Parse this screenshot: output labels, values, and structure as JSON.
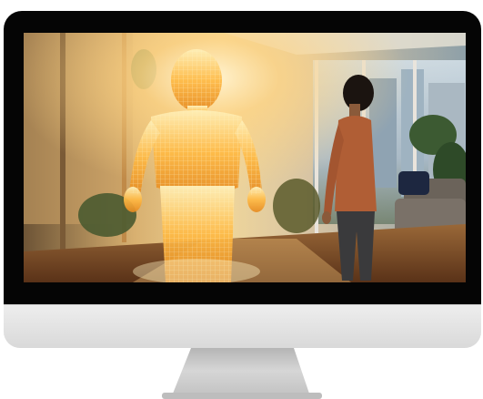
{
  "scene": {
    "subject": "child-facing-hologram",
    "palette": {
      "sunlight": "#ffd27a",
      "hologram": "#ffb43a",
      "wall": "#cfc7bb",
      "floor": "#7a4a24",
      "shirt": "#b05e35",
      "pants": "#3a3a3c",
      "hair": "#1b1410",
      "sofa": "#6b635a",
      "pillow": "#1d2740",
      "bezel": "#050505",
      "chin": "#e4e4e4",
      "stand": "#c9c9c9"
    }
  }
}
